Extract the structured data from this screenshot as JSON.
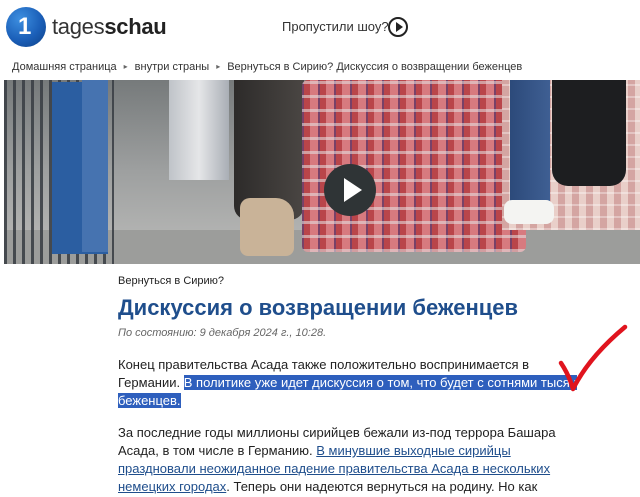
{
  "header": {
    "logo_mark": "1",
    "brand_prefix": "tages",
    "brand_bold": "schau",
    "missed_show": "Пропустили шоу?"
  },
  "breadcrumb": [
    {
      "label": "Домашняя страница"
    },
    {
      "label": "внутри страны"
    },
    {
      "label": "Вернуться в Сирию? Дискуссия о возвращении беженцев"
    }
  ],
  "article": {
    "topline": "Вернуться в Сирию?",
    "headline": "Дискуссия о возвращении беженцев",
    "date_prefix": "По состоянию",
    "date": "9 декабря 2024 г., 10:28.",
    "para1_plain": "Конец правительства Асада также положительно воспринимается в Германии.",
    "para1_selected": "В политике уже идет дискуссия о том, что будет с сотнями тысяч беженцев.",
    "para2_start": "За последние годы миллионы сирийцев бежали из-под террора Башара Асада, в том числе в Германию.",
    "para2_link": "В минувшие выходные сирийцы праздновали неожиданное падение правительства Асада в нескольких немецких городах",
    "para2_end": ". Теперь они надеются вернуться на родину. Но как"
  },
  "icons": {
    "play_small": "play-icon",
    "hero_play": "video-play-icon",
    "annotation": "red-checkmark"
  },
  "colors": {
    "headline_blue": "#1f4e8c",
    "selection": "#2e5fbd",
    "check_red": "#e0141e"
  }
}
